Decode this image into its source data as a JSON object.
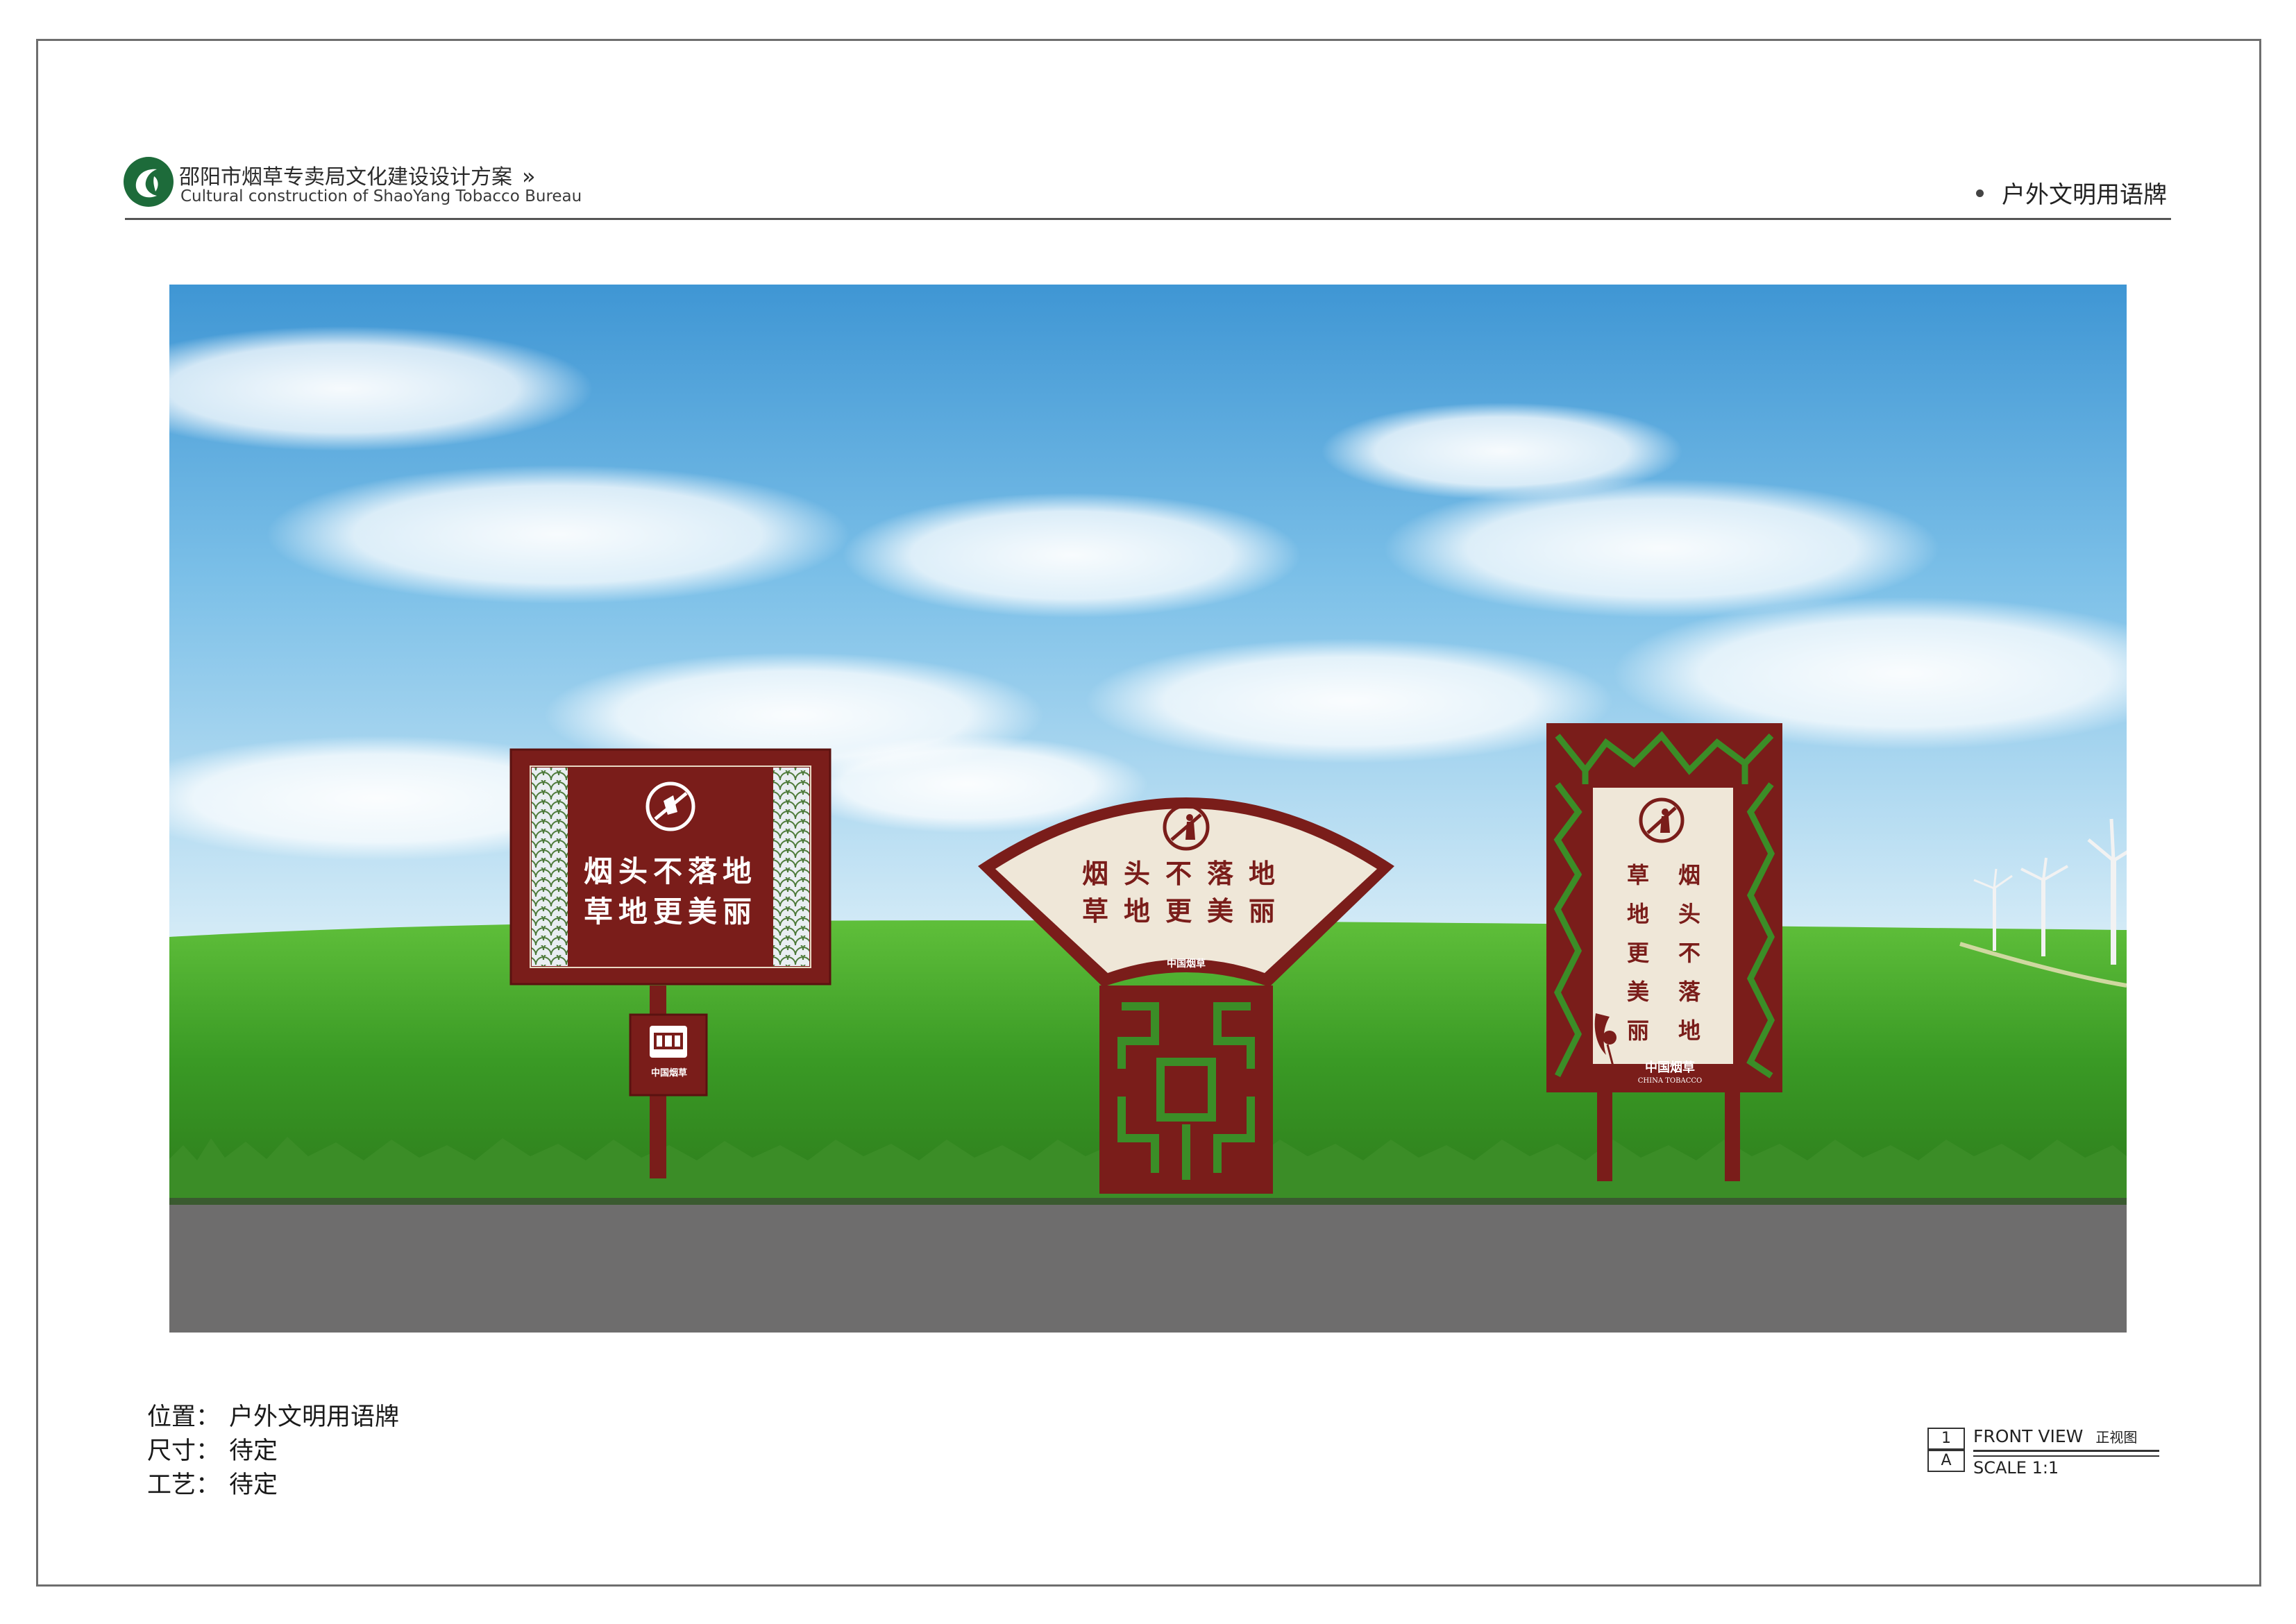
{
  "header": {
    "title_zh": "邵阳市烟草专卖局文化建设设计方案",
    "chevron": "»",
    "title_en": "Cultural construction of ShaoYang Tobacco Bureau",
    "section": "户外文明用语牌",
    "logo_icon": "tobacco-leaf-logo-icon"
  },
  "colors": {
    "sign_red": "#7a1d1a",
    "panel_cream": "#efe7d8",
    "logo_green": "#1d6b3a",
    "sky_top": "#4a9fd8",
    "grass": "#3c9a2a",
    "road": "#6e6d6d"
  },
  "signs": {
    "left": {
      "line1": "烟头不落地",
      "line2": "草地更美丽",
      "icon": "no-littering-icon",
      "brand": "中国烟草"
    },
    "center": {
      "line1": "烟头不落地",
      "line2": "草地更美丽",
      "icon": "no-littering-icon",
      "brand": "中国烟草"
    },
    "right": {
      "col1": "烟头不落地",
      "col2": "草地更美丽",
      "icon": "no-littering-icon",
      "brand": "中国烟草",
      "brand_en": "CHINA TOBACCO"
    }
  },
  "specs": {
    "location_label": "位置：",
    "location_value": "户外文明用语牌",
    "size_label": "尺寸：",
    "size_value": "待定",
    "craft_label": "工艺：",
    "craft_value": "待定"
  },
  "view": {
    "number": "1",
    "letter": "A",
    "title": "FRONT VIEW",
    "title_zh": "正视图",
    "scale": "SCALE 1:1"
  }
}
